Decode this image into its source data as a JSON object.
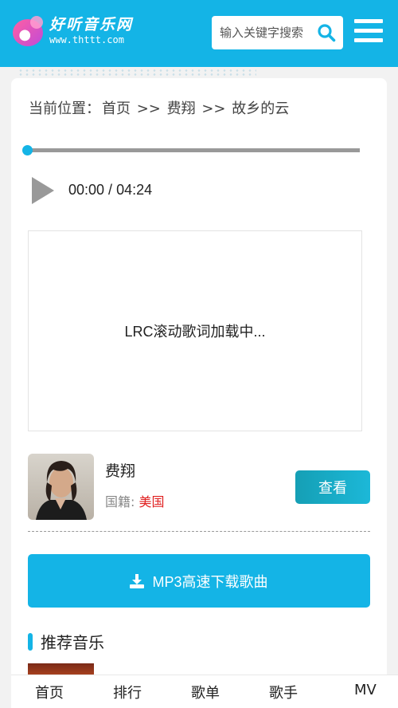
{
  "header": {
    "logo_title": "好听音乐网",
    "logo_url": "www.thttt.com",
    "search_placeholder": "输入关键字搜索",
    "accent_color": "#14b4e6"
  },
  "breadcrumb": {
    "prefix": "当前位置：",
    "home": "首页",
    "sep1": " >> ",
    "artist": "费翔",
    "sep2": " >> ",
    "song": "故乡的云"
  },
  "player": {
    "progress": 0,
    "current_time": "00:00",
    "time_separator": " / ",
    "duration": "04:24",
    "lyrics_status": "LRC滚动歌词加载中..."
  },
  "artist": {
    "name": "费翔",
    "nationality_label": "国籍:",
    "nationality_value": "美国",
    "view_label": "查看"
  },
  "download": {
    "label": "MP3高速下载歌曲"
  },
  "recommend": {
    "title": "推荐音乐"
  },
  "bottom_nav": {
    "items": [
      "首页",
      "排行",
      "歌单",
      "歌手",
      "MV"
    ]
  }
}
